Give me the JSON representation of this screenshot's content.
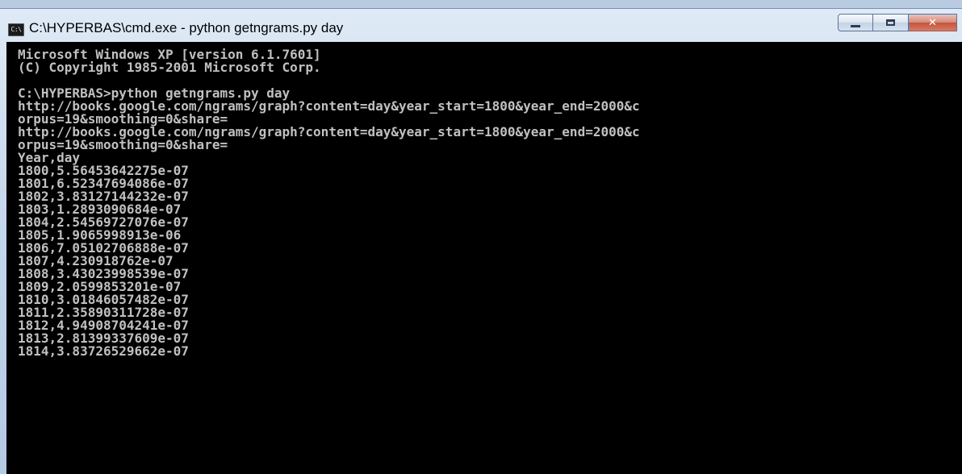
{
  "window": {
    "title": "C:\\HYPERBAS\\cmd.exe - python getngrams.py day",
    "icon_text": "C:\\"
  },
  "console": {
    "lines": [
      "Microsoft Windows XP [version 6.1.7601]",
      "(C) Copyright 1985-2001 Microsoft Corp.",
      "",
      "C:\\HYPERBAS>python getngrams.py day",
      "http://books.google.com/ngrams/graph?content=day&year_start=1800&year_end=2000&c",
      "orpus=19&smoothing=0&share=",
      "http://books.google.com/ngrams/graph?content=day&year_start=1800&year_end=2000&c",
      "orpus=19&smoothing=0&share=",
      "Year,day",
      "1800,5.56453642275e-07",
      "1801,6.52347694086e-07",
      "1802,3.83127144232e-07",
      "1803,1.2893090684e-07",
      "1804,2.54569727076e-07",
      "1805,1.9065998913e-06",
      "1806,7.05102706888e-07",
      "1807,4.230918762e-07",
      "1808,3.43023998539e-07",
      "1809,2.0599853201e-07",
      "1810,3.01846057482e-07",
      "1811,2.35890311728e-07",
      "1812,4.94908704241e-07",
      "1813,2.81399337609e-07",
      "1814,3.83726529662e-07"
    ]
  },
  "colors": {
    "console_bg": "#000000",
    "console_fg": "#c0c0c0",
    "close_button": "#c5543c"
  }
}
